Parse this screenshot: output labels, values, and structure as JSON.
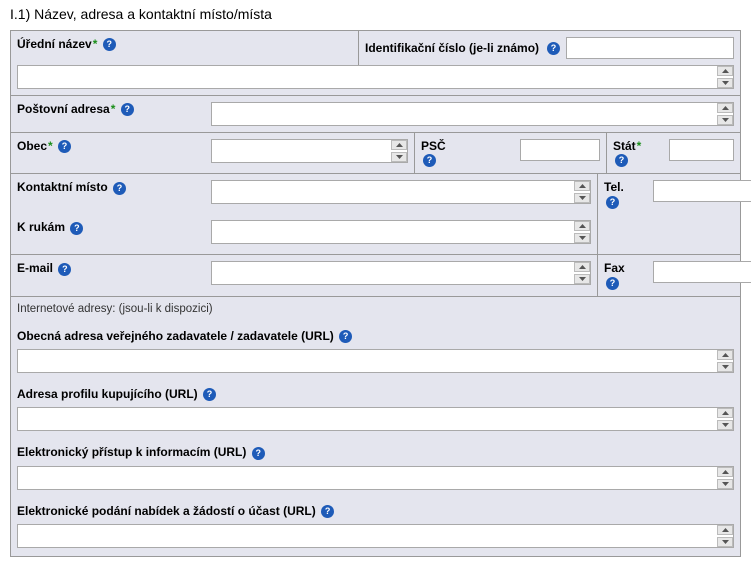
{
  "section_title": "I.1) Název, adresa a kontaktní místo/místa",
  "labels": {
    "uredni_nazev": "Úřední název",
    "id_cislo": "Identifikační číslo (je-li známo)",
    "postovni_adresa": "Poštovní adresa",
    "obec": "Obec",
    "psc": "PSČ",
    "stat": "Stát",
    "kontaktni_misto": "Kontaktní místo",
    "k_rukam": "K rukám",
    "tel": "Tel.",
    "email": "E-mail",
    "fax": "Fax",
    "internet_section": "Internetové adresy: (jsou-li k dispozici)",
    "url_obecna": "Obecná adresa veřejného zadavatele / zadavatele (URL)",
    "url_profil": "Adresa profilu kupujícího (URL)",
    "url_elektronicky_pristup": "Elektronický přístup k informacím (URL)",
    "url_elektronicke_podani": "Elektronické podání nabídek a žádostí o účast (URL)"
  },
  "required_marker": "*",
  "help_marker": "?",
  "values": {
    "uredni_nazev": "",
    "id_cislo": "",
    "postovni_adresa": "",
    "obec": "",
    "psc": "",
    "stat": "",
    "kontaktni_misto": "",
    "k_rukam": "",
    "tel": "",
    "email": "",
    "fax": "",
    "url_obecna": "",
    "url_profil": "",
    "url_elektronicky_pristup": "",
    "url_elektronicke_podani": ""
  }
}
